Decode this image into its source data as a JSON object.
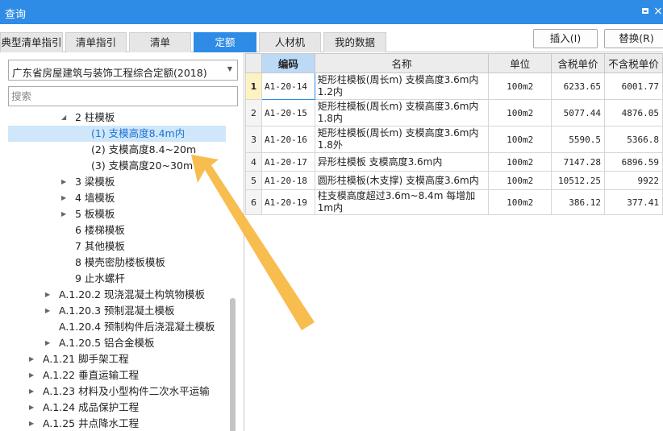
{
  "window": {
    "title": "查询"
  },
  "tabs": [
    {
      "label": "典型清单指引"
    },
    {
      "label": "清单指引"
    },
    {
      "label": "清单"
    },
    {
      "label": "定额"
    },
    {
      "label": "人材机"
    },
    {
      "label": "我的数据"
    }
  ],
  "toolbar": {
    "insert_label": "插入(I)",
    "replace_label": "替换(R)"
  },
  "left": {
    "select_value": "广东省房屋建筑与装饰工程综合定额(2018)",
    "search_placeholder": "搜索"
  },
  "tree": [
    {
      "label": "2 柱模板",
      "expanded": true
    },
    {
      "label": "(1) 支模高度8.4m内",
      "selected": true
    },
    {
      "label": "(2) 支模高度8.4~20m"
    },
    {
      "label": "(3) 支模高度20~30m"
    },
    {
      "label": "3 梁模板"
    },
    {
      "label": "4 墙模板"
    },
    {
      "label": "5 板模板"
    },
    {
      "label": "6 楼梯模板"
    },
    {
      "label": "7 其他模板"
    },
    {
      "label": "8 模壳密肋楼板模板"
    },
    {
      "label": "9 止水螺杆"
    },
    {
      "label": "A.1.20.2 现浇混凝土构筑物模板"
    },
    {
      "label": "A.1.20.3 预制混凝土模板"
    },
    {
      "label": "A.1.20.4 预制构件后浇混凝土模板"
    },
    {
      "label": "A.1.20.5 铝合金模板"
    },
    {
      "label": "A.1.21 脚手架工程"
    },
    {
      "label": "A.1.22 垂直运输工程"
    },
    {
      "label": "A.1.23 材料及小型构件二次水平运输"
    },
    {
      "label": "A.1.24 成品保护工程"
    },
    {
      "label": "A.1.25 井点降水工程"
    }
  ],
  "table": {
    "headers": [
      "",
      "编码",
      "名称",
      "单位",
      "含税单价",
      "不含税单价"
    ],
    "rows": [
      {
        "num": "1",
        "code": "A1-20-14",
        "name": "矩形柱模板(周长m) 支模高度3.6m内 1.2内",
        "unit": "100m2",
        "price_tax": "6233.65",
        "price_notax": "6001.77"
      },
      {
        "num": "2",
        "code": "A1-20-15",
        "name": "矩形柱模板(周长m) 支模高度3.6m内 1.8内",
        "unit": "100m2",
        "price_tax": "5077.44",
        "price_notax": "4876.05"
      },
      {
        "num": "3",
        "code": "A1-20-16",
        "name": "矩形柱模板(周长m) 支模高度3.6m内 1.8外",
        "unit": "100m2",
        "price_tax": "5590.5",
        "price_notax": "5366.8"
      },
      {
        "num": "4",
        "code": "A1-20-17",
        "name": "异形柱模板 支模高度3.6m内",
        "unit": "100m2",
        "price_tax": "7147.28",
        "price_notax": "6896.59"
      },
      {
        "num": "5",
        "code": "A1-20-18",
        "name": "圆形柱模板(木支撑) 支模高度3.6m内",
        "unit": "100m2",
        "price_tax": "10512.25",
        "price_notax": "9922"
      },
      {
        "num": "6",
        "code": "A1-20-19",
        "name": "柱支模高度超过3.6m~8.4m 每增加1m内",
        "unit": "100m2",
        "price_tax": "386.12",
        "price_notax": "377.41"
      }
    ]
  },
  "colors": {
    "accent": "#2e8ce6",
    "selection": "#cfe6fb",
    "annotation": "#f6b73c"
  },
  "icons": {
    "restore": "restore-icon",
    "expand": "triangle-right-icon",
    "collapse": "triangle-down-icon"
  }
}
